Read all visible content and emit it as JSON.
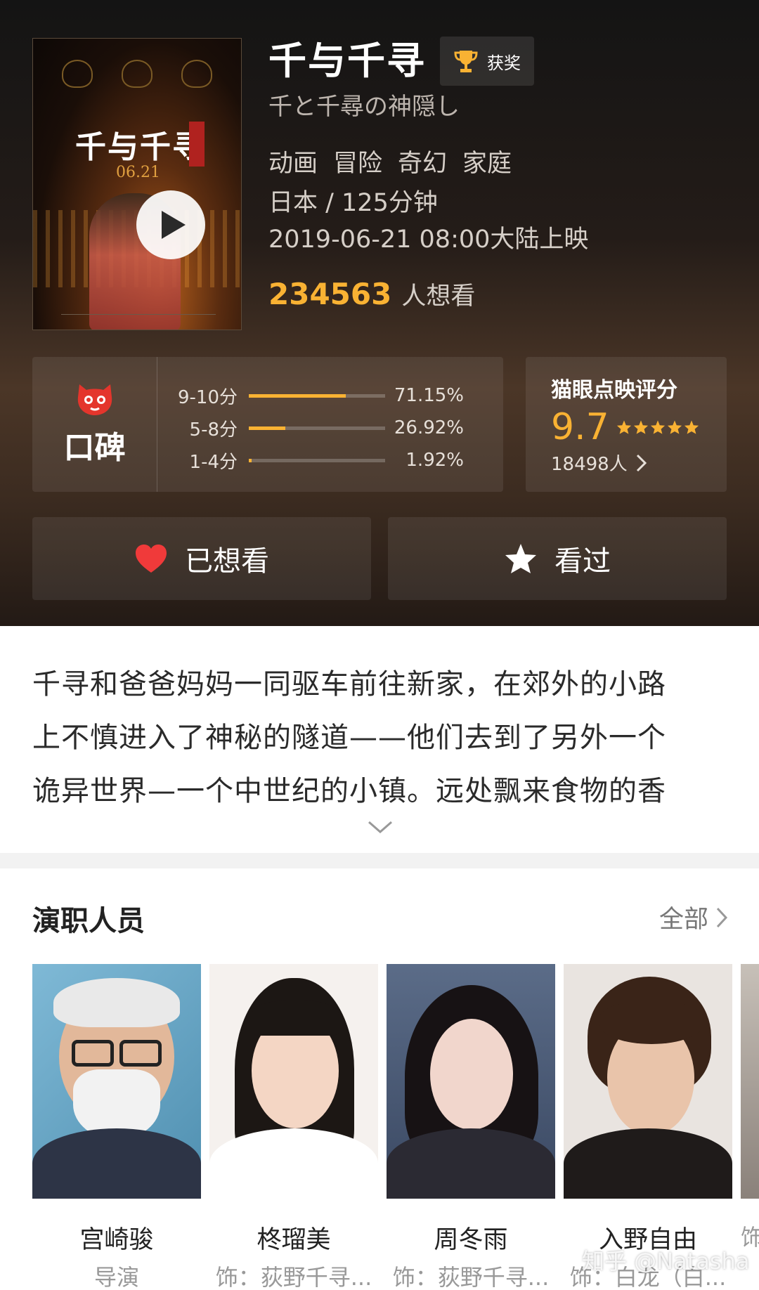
{
  "movie": {
    "title": "千与千寻",
    "award_label": "获奖",
    "original_title": "千と千尋の神隠し",
    "genres": [
      "动画",
      "冒险",
      "奇幻",
      "家庭"
    ],
    "country_duration": "日本 / 125分钟",
    "release": "2019-06-21 08:00大陆上映",
    "wish_count": "234563",
    "wish_suffix": "人想看"
  },
  "poster": {
    "title": "千与千寻",
    "date": "06.21",
    "play_icon": "play-icon"
  },
  "koubei": {
    "label": "口碑",
    "distribution": [
      {
        "label": "9-10分",
        "percent": "71.15%",
        "value": 71.15
      },
      {
        "label": "5-8分",
        "percent": "26.92%",
        "value": 26.92
      },
      {
        "label": "1-4分",
        "percent": "1.92%",
        "value": 1.92
      }
    ]
  },
  "maoyan": {
    "title": "猫眼点映评分",
    "score": "9.7",
    "stars": 5,
    "count": "18498人"
  },
  "actions": {
    "wish_label": "已想看",
    "seen_label": "看过"
  },
  "synopsis": {
    "lines": [
      "千寻和爸爸妈妈一同驱车前往新家，在郊外的小路",
      "上不慎进入了神秘的隧道——他们去到了另外一个",
      "诡异世界—一个中世纪的小镇。远处飘来食物的香"
    ]
  },
  "cast": {
    "title": "演职人员",
    "all_label": "全部",
    "members": [
      {
        "name": "宫崎骏",
        "role": "导演"
      },
      {
        "name": "柊瑠美",
        "role": "饰：荻野千寻..."
      },
      {
        "name": "周冬雨",
        "role": "饰：荻野千寻..."
      },
      {
        "name": "入野自由",
        "role": "饰：白龙（白..."
      },
      {
        "name": "",
        "role": "饰"
      }
    ]
  },
  "watermark": "知乎 @Natasha",
  "colors": {
    "accent": "#f9b233",
    "heart": "#f03a3a",
    "brand_red": "#e4352c"
  }
}
